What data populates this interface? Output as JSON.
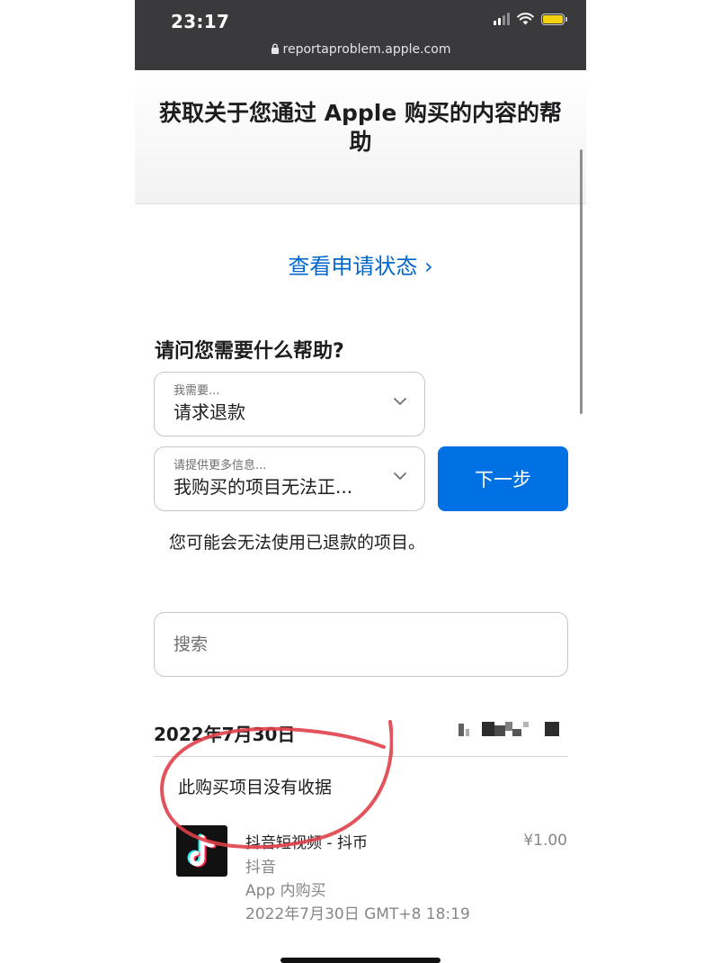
{
  "status_bar": {
    "time": "23:17",
    "url": "reportaproblem.apple.com"
  },
  "header": {
    "title": "获取关于您通过 Apple 购买的内容的帮助"
  },
  "status_link": {
    "label": "查看申请状态 ›"
  },
  "help_form": {
    "question": "请问您需要什么帮助?",
    "need_select": {
      "caption": "我需要...",
      "value": "请求退款"
    },
    "info_select": {
      "caption": "请提供更多信息...",
      "value": "我购买的项目无法正..."
    },
    "next_label": "下一步",
    "notice": "您可能会无法使用已退款的项目。"
  },
  "search": {
    "placeholder": "搜索"
  },
  "purchase": {
    "date": "2022年7月30日",
    "no_receipt": "此购买项目没有收据",
    "item": {
      "name": "抖音短视频 - 抖币",
      "app": "抖音",
      "type": "App 内购买",
      "datetime": "2022年7月30日 GMT+8 18:19",
      "price": "¥1.00"
    }
  },
  "colors": {
    "link_blue": "#0066cc",
    "button_blue": "#0071e3",
    "annotation_red": "#e0404a"
  }
}
